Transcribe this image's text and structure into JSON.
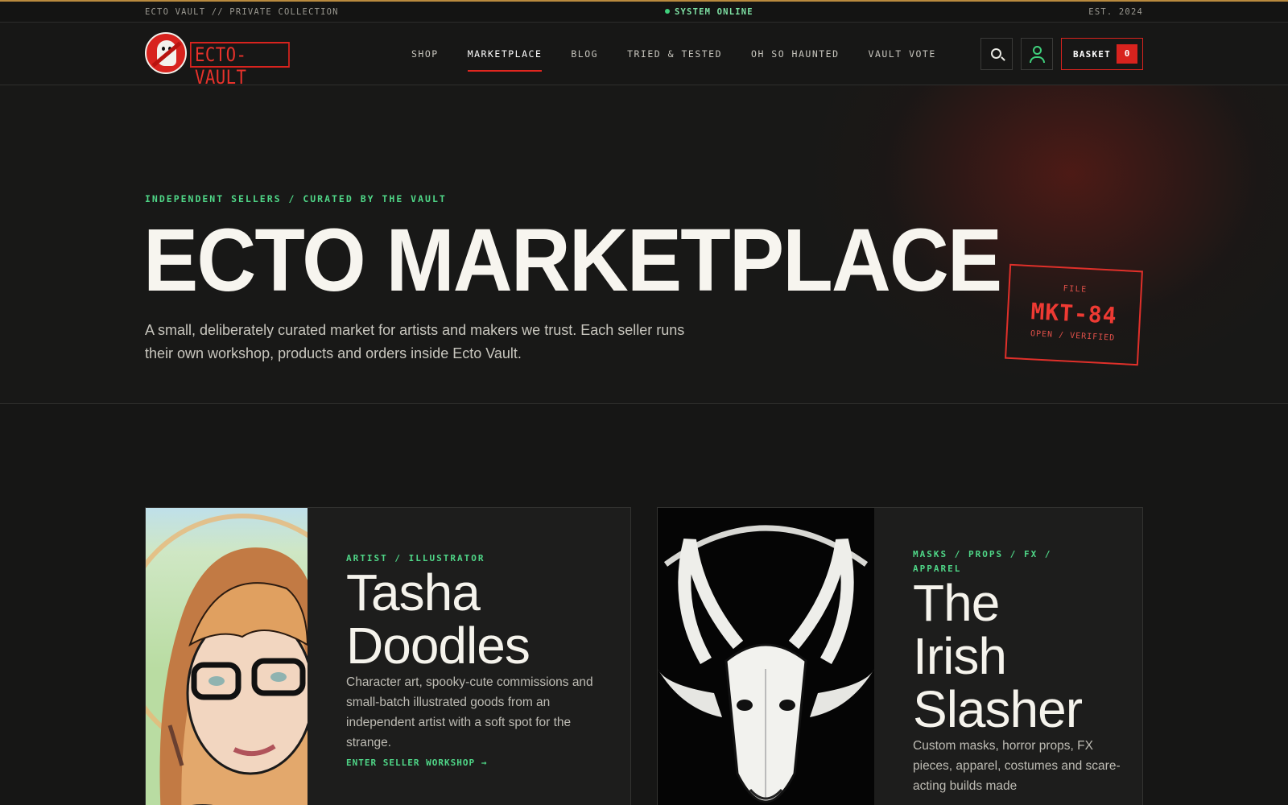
{
  "topbar": {
    "left": "ECTO VAULT // PRIVATE COLLECTION",
    "status": "SYSTEM ONLINE",
    "right": "EST. 2024"
  },
  "brand": {
    "logo_text": "ECTO-VAULT",
    "accent": "#d8231e",
    "green": "#3fd07c"
  },
  "nav": {
    "items": [
      {
        "label": "SHOP",
        "active": false
      },
      {
        "label": "MARKETPLACE",
        "active": true
      },
      {
        "label": "BLOG",
        "active": false
      },
      {
        "label": "TRIED & TESTED",
        "active": false
      },
      {
        "label": "OH SO HAUNTED",
        "active": false
      },
      {
        "label": "VAULT VOTE",
        "active": false
      }
    ]
  },
  "actions": {
    "search_icon": "search-icon",
    "user_icon": "user-icon",
    "basket_label": "BASKET",
    "basket_count": "0"
  },
  "hero": {
    "kicker": "INDEPENDENT SELLERS / CURATED BY THE VAULT",
    "title": "ECTO MARKETPLACE",
    "description": "A small, deliberately curated market for artists and makers we trust. Each seller runs their own workshop, products and orders inside Ecto Vault.",
    "stamp": {
      "top": "FILE",
      "id": "MKT-84",
      "bottom": "OPEN / VERIFIED"
    }
  },
  "sellers": [
    {
      "kicker": "ARTIST / ILLUSTRATOR",
      "name_lines": [
        "Tasha",
        "Doodles"
      ],
      "description": "Character art, spooky-cute commissions and small-batch illustrated goods from an independent artist with a soft spot for the strange.",
      "link": "ENTER SELLER WORKSHOP →"
    },
    {
      "kicker_lines": [
        "MASKS / PROPS / FX /",
        "APPAREL"
      ],
      "name_lines": [
        "The",
        "Irish",
        "Slasher"
      ],
      "description": "Custom masks, horror props, FX pieces, apparel, costumes and scare-acting builds made"
    }
  ]
}
